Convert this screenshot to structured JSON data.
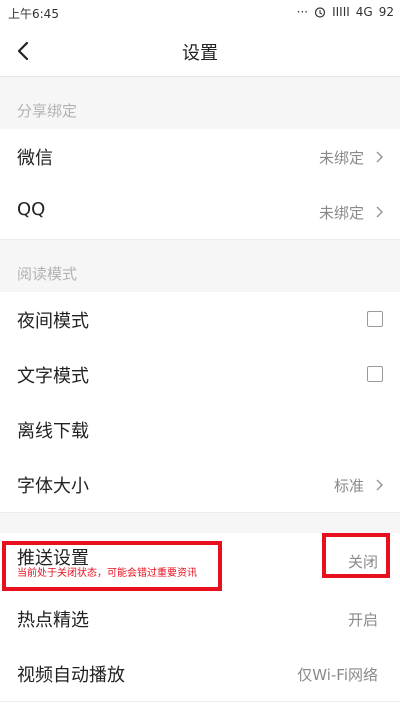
{
  "status_bar": {
    "time": "上午6:45",
    "dots": "···",
    "signal_bars": "IIIII",
    "network": "4G",
    "battery": "92"
  },
  "header": {
    "title": "设置"
  },
  "sections": {
    "share_binding": {
      "label": "分享绑定",
      "wechat": {
        "label": "微信",
        "value": "未绑定"
      },
      "qq": {
        "label": "QQ",
        "value": "未绑定"
      }
    },
    "reading_mode": {
      "label": "阅读模式",
      "night_mode": {
        "label": "夜间模式",
        "checked": false
      },
      "text_mode": {
        "label": "文字模式",
        "checked": false
      },
      "offline_download": {
        "label": "离线下载"
      },
      "font_size": {
        "label": "字体大小",
        "value": "标准"
      }
    },
    "notifications": {
      "push_settings": {
        "label": "推送设置",
        "value": "关闭",
        "hint": "当前处于关闭状态，可能会错过重要资讯"
      },
      "hot_picks": {
        "label": "热点精选",
        "value": "开启"
      },
      "autoplay_video": {
        "label": "视频自动播放",
        "value": "仅Wi-Fi网络"
      }
    }
  },
  "colors": {
    "highlight": "#e8101e",
    "section_bg": "#f6f6f6",
    "secondary_text": "#8a8a8a"
  }
}
